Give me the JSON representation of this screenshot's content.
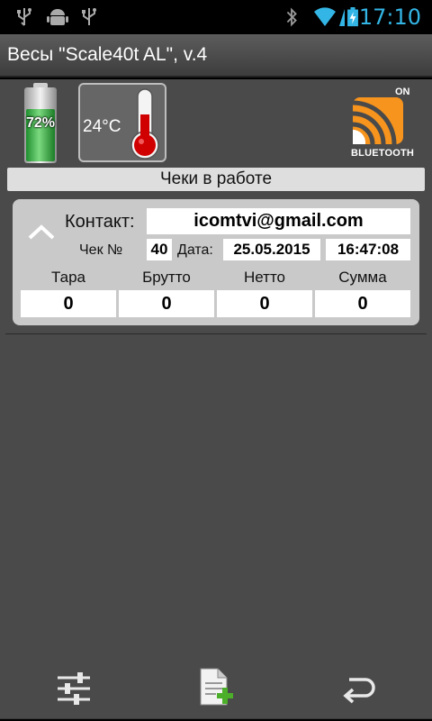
{
  "status_bar": {
    "time": "17:10",
    "icons": [
      "usb-icon",
      "android-debug-icon",
      "usb-icon",
      "bluetooth-icon",
      "wifi-icon",
      "signal-icon",
      "battery-charging-icon"
    ]
  },
  "app": {
    "title": "Весы \"Scale40t AL\", v.4"
  },
  "indicators": {
    "battery": {
      "percent_label": "72%",
      "level": 0.72,
      "color": "#3bb54a"
    },
    "temperature": {
      "label": "24°C"
    },
    "bluetooth": {
      "state": "ON",
      "label": "BLUETOOTH",
      "color": "#f7941d"
    }
  },
  "section": {
    "title": "Чеки в работе"
  },
  "check": {
    "contact_label": "Контакт:",
    "contact": "icomtvi@gmail.com",
    "number_label": "Чек №",
    "number": "40",
    "date_label": "Дата:",
    "date": "25.05.2015",
    "time": "16:47:08",
    "columns": [
      {
        "label": "Тара",
        "value": "0"
      },
      {
        "label": "Брутто",
        "value": "0"
      },
      {
        "label": "Нетто",
        "value": "0"
      },
      {
        "label": "Сумма",
        "value": "0"
      }
    ]
  },
  "bottom_bar": {
    "icons": [
      "settings-sliders-icon",
      "add-document-icon",
      "back-icon"
    ]
  }
}
